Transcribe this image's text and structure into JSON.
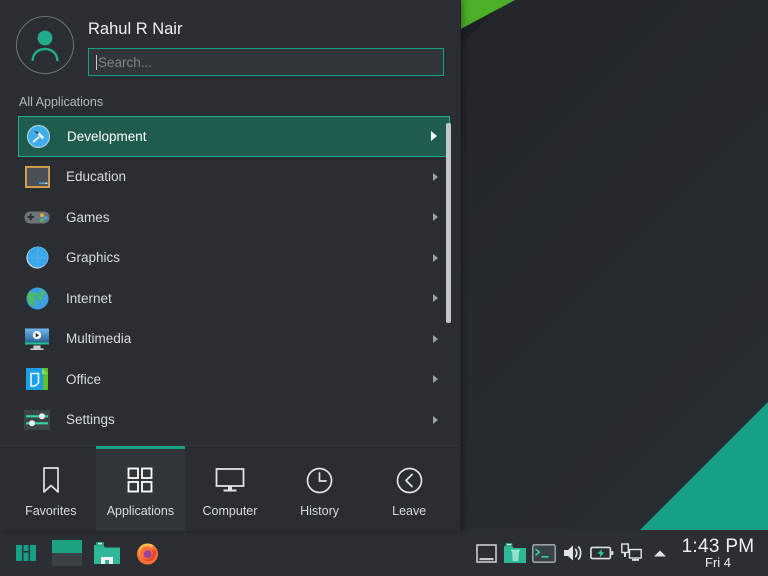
{
  "desktop": {
    "wallpaper_dark": "#1e2124",
    "wallpaper_light": "#2a2f33",
    "accent_green": "#4caf28",
    "accent_teal": "#16a085"
  },
  "menu": {
    "user_name": "Rahul R Nair",
    "avatar_icon": "user-avatar-icon",
    "search": {
      "value": "",
      "placeholder": "Search..."
    },
    "breadcrumb": "All Applications",
    "categories": [
      {
        "label": "Development",
        "icon": "hammer-icon",
        "selected": true
      },
      {
        "label": "Education",
        "icon": "chalkboard-icon",
        "selected": false
      },
      {
        "label": "Games",
        "icon": "gamepad-icon",
        "selected": false
      },
      {
        "label": "Graphics",
        "icon": "sphere-icon",
        "selected": false
      },
      {
        "label": "Internet",
        "icon": "globe-icon",
        "selected": false
      },
      {
        "label": "Multimedia",
        "icon": "media-player-icon",
        "selected": false
      },
      {
        "label": "Office",
        "icon": "document-icon",
        "selected": false
      },
      {
        "label": "Settings",
        "icon": "sliders-icon",
        "selected": false
      }
    ],
    "tabs": [
      {
        "label": "Favorites",
        "icon": "bookmark-icon",
        "active": false
      },
      {
        "label": "Applications",
        "icon": "grid-icon",
        "active": true
      },
      {
        "label": "Computer",
        "icon": "monitor-icon",
        "active": false
      },
      {
        "label": "History",
        "icon": "clock-icon",
        "active": false
      },
      {
        "label": "Leave",
        "icon": "back-arrow-icon",
        "active": false
      }
    ]
  },
  "panel": {
    "launchers": [
      {
        "name": "manjaro-menu-icon"
      },
      {
        "name": "pager-widget"
      },
      {
        "name": "file-manager-icon"
      },
      {
        "name": "firefox-icon"
      }
    ],
    "tray": [
      {
        "name": "minimize-all-icon"
      },
      {
        "name": "trash-icon"
      },
      {
        "name": "terminal-icon"
      },
      {
        "name": "volume-icon"
      },
      {
        "name": "battery-icon"
      },
      {
        "name": "network-icon"
      },
      {
        "name": "show-hidden-icon"
      }
    ],
    "clock": {
      "time": "1:43 PM",
      "date": "Fri 4"
    }
  }
}
